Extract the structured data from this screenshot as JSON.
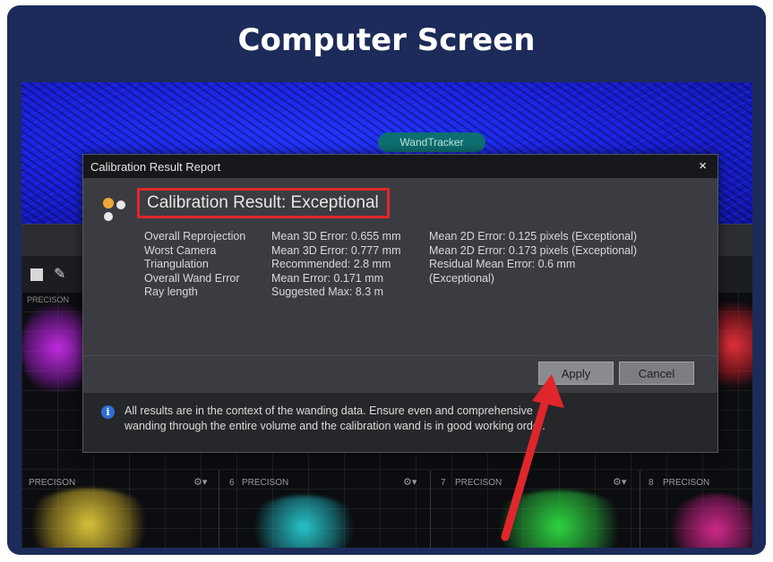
{
  "card": {
    "title": "Computer Screen"
  },
  "app": {
    "wand_tag": "WandTracker",
    "precision_label": "PRECISON",
    "cameras": [
      {
        "number": "",
        "label": "PRECISON"
      },
      {
        "number": "6",
        "label": "PRECISON"
      },
      {
        "number": "7",
        "label": "PRECISON"
      },
      {
        "number": "8",
        "label": "PRECISON"
      }
    ]
  },
  "dialog": {
    "title": "Calibration Result Report",
    "close_symbol": "×",
    "result": "Calibration Result: Exceptional",
    "metrics": [
      {
        "label": "Overall Reprojection",
        "value1": "Mean 3D Error: 0.655 mm",
        "value2": "Mean 2D Error: 0.125 pixels (Exceptional)"
      },
      {
        "label": "Worst Camera",
        "value1": "Mean 3D Error: 0.777 mm",
        "value2": "Mean 2D Error: 0.173 pixels (Exceptional)"
      },
      {
        "label": "Triangulation",
        "value1": "Recommended: 2.8 mm",
        "value2": "Residual Mean Error: 0.6 mm"
      },
      {
        "label": "Overall Wand Error",
        "value1": "Mean Error: 0.171 mm",
        "value2": "(Exceptional)"
      },
      {
        "label": "Ray length",
        "value1": "Suggested Max: 8.3 m",
        "value2": ""
      }
    ],
    "apply_label": "Apply",
    "cancel_label": "Cancel",
    "info_line1": "All results are in the context of the wanding data.  Ensure even and comprehensive",
    "info_line2": "wanding through the entire volume and the calibration wand is in good working order."
  },
  "colors": {
    "highlight": "#e0262a",
    "background": "#1c2b59"
  }
}
